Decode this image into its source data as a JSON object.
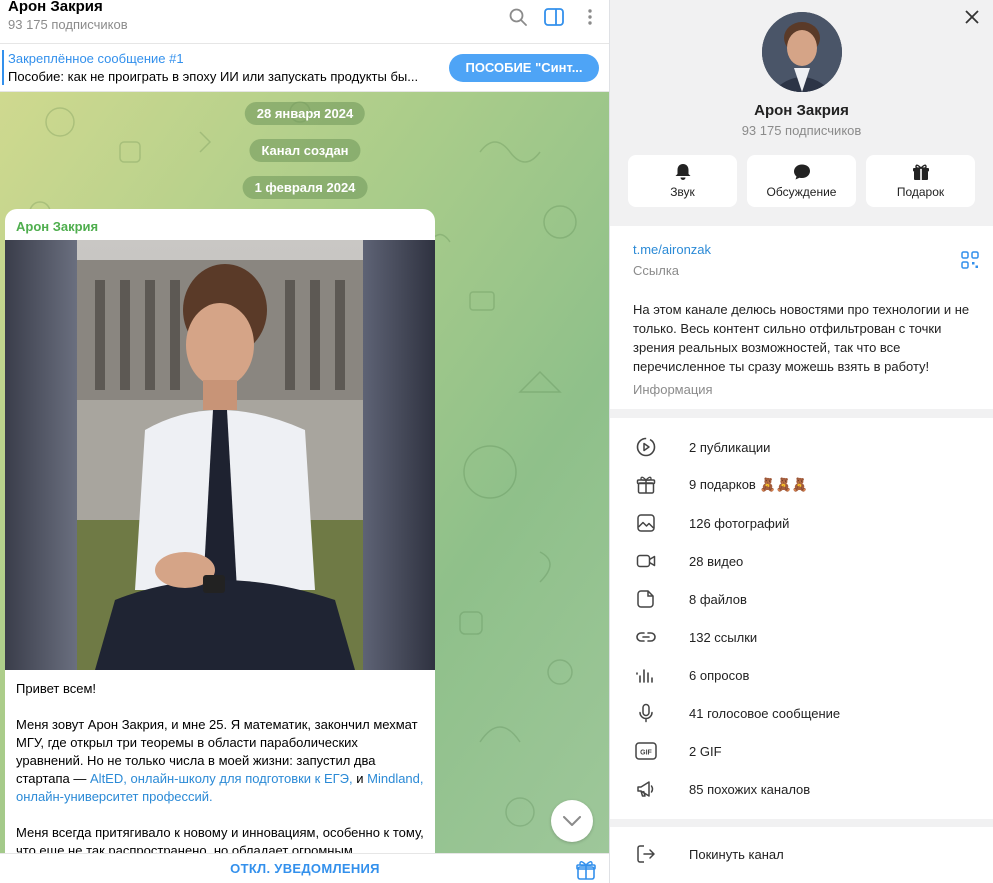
{
  "chat": {
    "title": "Арон Закрия",
    "subscribers": "93 175 подписчиков",
    "pinned": {
      "title": "Закреплённое сообщение #1",
      "body": "Пособие: как не проиграть в эпоху ИИ или запускать продукты бы...",
      "button": "ПОСОБИЕ \"Синт..."
    },
    "dates": [
      "28 января 2024",
      "Канал создан",
      "1 февраля 2024"
    ],
    "message": {
      "author": "Арон Закрия",
      "greeting": "Привет всем!",
      "p1_start": "Меня зовут Арон Закрия, и мне 25. Я математик, закончил мехмат МГУ, где открыл три теоремы в области параболических уравнений. Но не только числа в моей жизни: запустил два стартапа — ",
      "link1": "AltED, онлайн-школу для подготовки к ЕГЭ,",
      "p1_mid": " и ",
      "link2": "Mindland, онлайн-университет профессий.",
      "p2": "Меня всегда притягивало к новому и инновациям, особенно к тому, что еще не так распространено, но обладает огромным"
    },
    "bottom_button": "ОТКЛ. УВЕДОМЛЕНИЯ"
  },
  "panel": {
    "name": "Арон Закрия",
    "subscribers": "93 175 подписчиков",
    "actions": [
      {
        "label": "Звук",
        "icon": "bell-icon"
      },
      {
        "label": "Обсуждение",
        "icon": "chat-bubble-icon"
      },
      {
        "label": "Подарок",
        "icon": "gift-icon"
      }
    ],
    "link": "t.me/aironzak",
    "link_caption": "Ссылка",
    "description": "На этом канале делюсь новостями про технологии и не только. Весь контент сильно отфильтрован с точки зрения реальных возможностей, так что все перечисленное ты сразу можешь взять в работу!",
    "description_caption": "Информация",
    "media": [
      {
        "label": "2 публикации",
        "icon": "stories-icon"
      },
      {
        "label": "9 подарков 🧸🧸🧸",
        "icon": "gift-icon"
      },
      {
        "label": "126 фотографий",
        "icon": "photo-icon"
      },
      {
        "label": "28 видео",
        "icon": "video-icon"
      },
      {
        "label": "8 файлов",
        "icon": "file-icon"
      },
      {
        "label": "132 ссылки",
        "icon": "link-icon"
      },
      {
        "label": "6 опросов",
        "icon": "poll-icon"
      },
      {
        "label": "41 голосовое сообщение",
        "icon": "microphone-icon"
      },
      {
        "label": "2 GIF",
        "icon": "gif-icon"
      },
      {
        "label": "85 похожих каналов",
        "icon": "megaphone-icon"
      }
    ],
    "leave": "Покинуть канал"
  },
  "colors": {
    "accent": "#3390ec",
    "author": "#4fae4e",
    "link": "#2b8ad6"
  }
}
